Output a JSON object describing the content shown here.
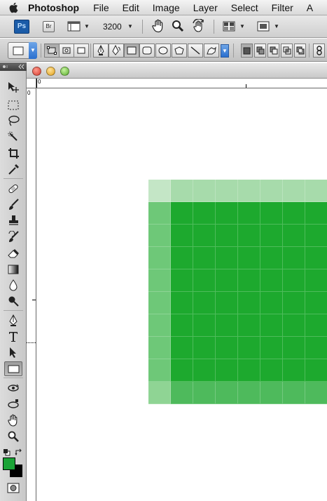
{
  "menubar": {
    "app_name": "Photoshop",
    "items": [
      "File",
      "Edit",
      "Image",
      "Layer",
      "Select",
      "Filter",
      "A"
    ]
  },
  "appbar": {
    "ps_logo": "Ps",
    "bridge_logo": "Br",
    "zoom_value": "3200"
  },
  "tools": {
    "foreground_color": "#1aa336",
    "background_color": "#000000"
  },
  "rulers": {
    "top_origin": "0",
    "left_origin": "0"
  },
  "image": {
    "colors": {
      "corner_top_left": "#c4e6c6",
      "top_row": "#a7dbab",
      "left_col": "#6ec878",
      "center": "#1da92e",
      "bottom_left": "#8fd494",
      "bottom_row": "#4eba5c"
    },
    "columns": 8,
    "rows": 10
  }
}
